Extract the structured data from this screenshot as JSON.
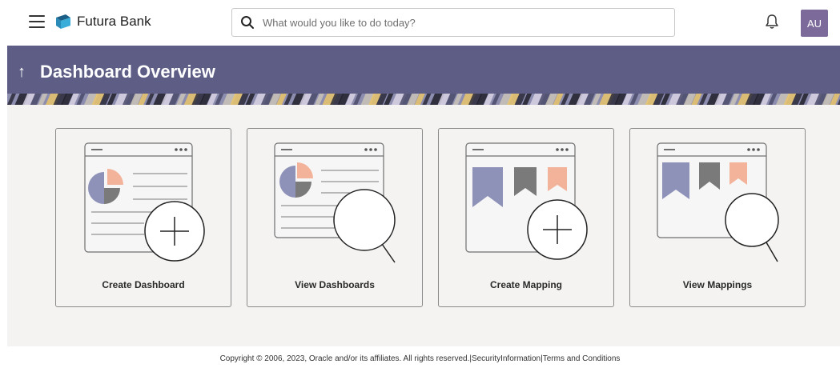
{
  "brand": {
    "name": "Futura Bank"
  },
  "search": {
    "placeholder": "What would you like to do today?"
  },
  "user": {
    "initials": "AU"
  },
  "page": {
    "title": "Dashboard Overview"
  },
  "cards": [
    {
      "label": "Create Dashboard",
      "icon": "create-dashboard-icon"
    },
    {
      "label": "View Dashboards",
      "icon": "view-dashboards-icon"
    },
    {
      "label": "Create Mapping",
      "icon": "create-mapping-icon"
    },
    {
      "label": "View Mappings",
      "icon": "view-mappings-icon"
    }
  ],
  "footer": {
    "copyright": "Copyright © 2006, 2023, Oracle and/or its affiliates. All rights reserved.|",
    "security": "SecurityInformation",
    "separator": "|",
    "terms": "Terms and Conditions"
  },
  "colors": {
    "banner": "#5d5d86",
    "avatar": "#7b6a9a",
    "chart_blue": "#8e92b8",
    "chart_peach": "#f3b39b",
    "chart_grey": "#7a7a7a"
  }
}
